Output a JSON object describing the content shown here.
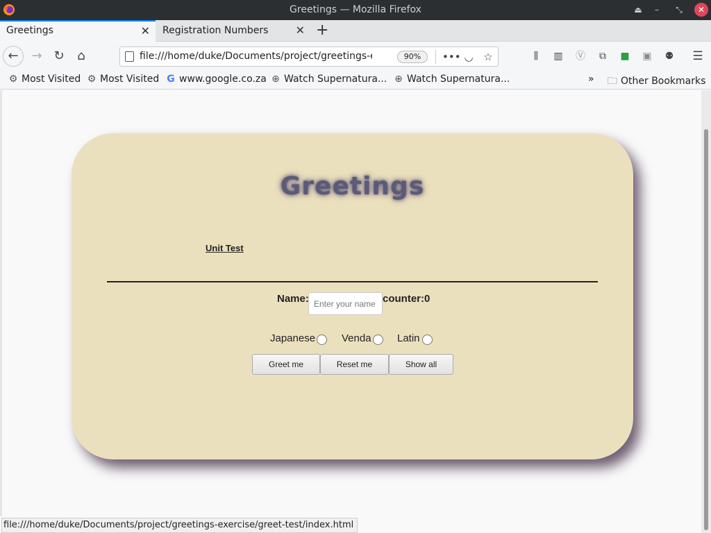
{
  "window": {
    "title": "Greetings — Mozilla Firefox"
  },
  "tabs": [
    {
      "label": "Greetings",
      "active": true
    },
    {
      "label": "Registration Numbers",
      "active": false
    }
  ],
  "navbar": {
    "url": "file:///home/duke/Documents/project/greetings-exercise/greet-test/index.html",
    "zoom": "90%"
  },
  "bookmarks": {
    "items": [
      {
        "label": "Most Visited",
        "icon": "gear-icon"
      },
      {
        "label": "Most Visited",
        "icon": "gear-icon"
      },
      {
        "label": "www.google.co.za",
        "icon": "google-icon"
      },
      {
        "label": "Watch Supernatura...",
        "icon": "globe-icon"
      },
      {
        "label": "Watch Supernatura...",
        "icon": "globe-icon"
      }
    ],
    "other": "Other Bookmarks"
  },
  "page": {
    "heading": "Greetings",
    "unit_test_link": "Unit Test",
    "name_label": "Name:",
    "name_placeholder": "Enter your name",
    "counter_label": "counter:0",
    "languages": [
      "Japanese",
      "Venda",
      "Latin"
    ],
    "buttons": {
      "greet": "Greet me",
      "reset": "Reset me",
      "show_all": "Show all"
    }
  },
  "status_bar": {
    "text": "file:///home/duke/Documents/project/greetings-exercise/greet-test/index.html"
  },
  "colors": {
    "card_background": "#ebe0bd",
    "heading_color": "#5b5b78",
    "card_shadow": "#6d5e70",
    "tab_accent": "#0a84ff",
    "close_button": "#e0475b"
  }
}
